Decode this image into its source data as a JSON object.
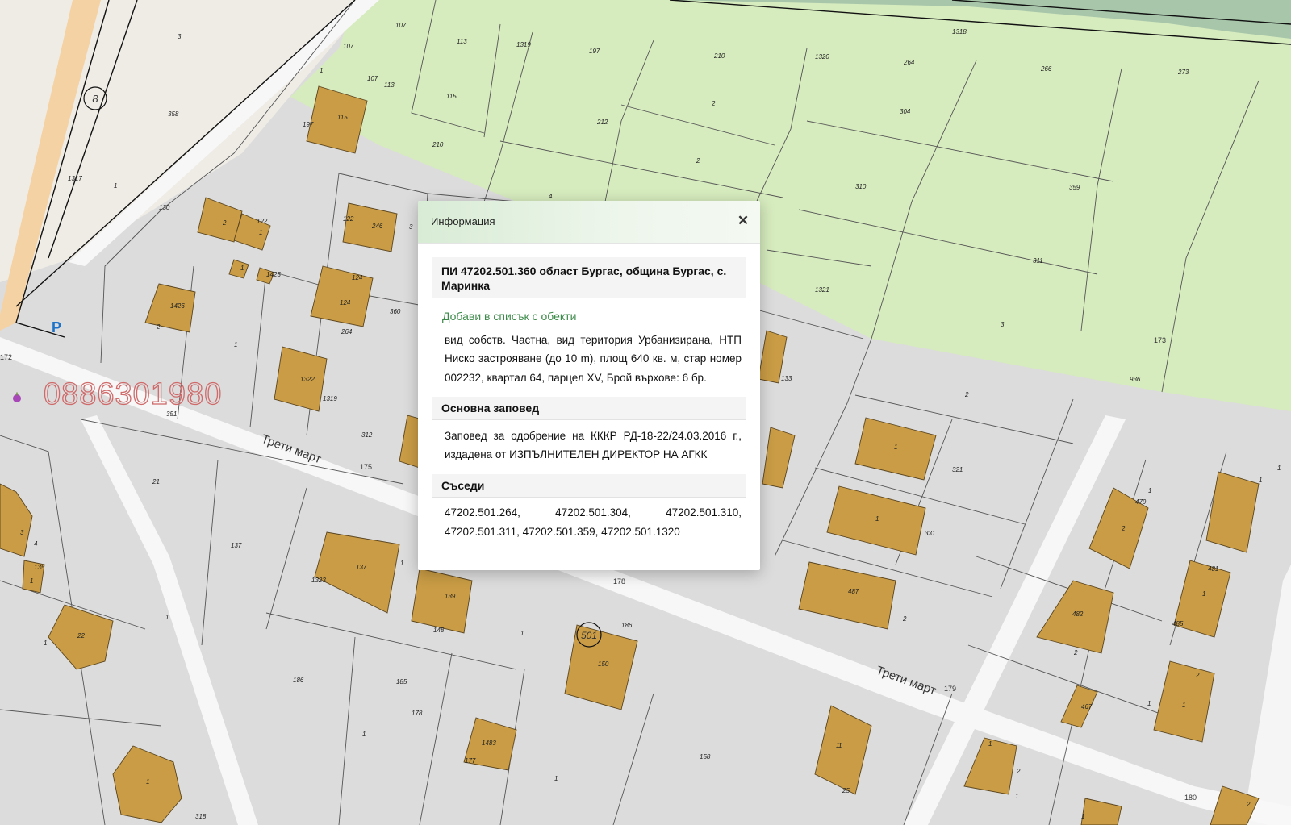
{
  "popup": {
    "title": "Информация",
    "close_icon": "close-icon",
    "parcel_title": "ПИ 47202.501.360 област Бургас, община Бургас, с. Маринка",
    "add_link": "Добави в списък с обекти",
    "description": "вид собств. Частна, вид територия Урбанизирана, НТП Ниско застрояване (до 10 m), площ 640 кв. м, стар номер 002232, квартал 64, парцел XV, Брой върхове: 6 бр.",
    "order_heading": "Основна заповед",
    "order_text": "Заповед за одобрение на КККР РД-18-22/24.03.2016 г., издадена от ИЗПЪЛНИТЕЛЕН ДИРЕКТОР НА АГКК",
    "neighbors_heading": "Съседи",
    "neighbors_text": "47202.501.264, 47202.501.304, 47202.501.310, 47202.501.311, 47202.501.359, 47202.501.1320"
  },
  "map": {
    "colors": {
      "background": "#dcdcdc",
      "agricultural": "#d6ebbe",
      "forest": "#9fbfa7",
      "building": "#c99c45",
      "road": "#f7f7f7",
      "highway": "#f5d2a3",
      "parcel_line": "#333333",
      "watermark": "#d06a6a"
    },
    "watermark_phone": "0886301980",
    "streets": [
      "Трети март",
      "Трети март"
    ],
    "parking_label": "P",
    "circle_labels": [
      "8",
      "501"
    ],
    "poi_labels": [
      "172",
      "175",
      "178",
      "179",
      "173",
      "180"
    ],
    "plot_numbers": [
      "107",
      "113",
      "1319",
      "197",
      "210",
      "1320",
      "264",
      "266",
      "273",
      "1318",
      "107",
      "107",
      "113",
      "115",
      "1",
      "115",
      "197",
      "210",
      "212",
      "2",
      "2",
      "3",
      "358",
      "1317",
      "1",
      "130",
      "2",
      "122",
      "1",
      "122",
      "246",
      "3",
      "4",
      "1",
      "1425",
      "1426",
      "2",
      "1",
      "124",
      "124",
      "264",
      "360",
      "304",
      "310",
      "359",
      "311",
      "1321",
      "3",
      "936",
      "1322",
      "1319",
      "351",
      "312",
      "133",
      "2",
      "21",
      "3",
      "4",
      "135",
      "1",
      "137",
      "137",
      "1",
      "1323",
      "1",
      "22",
      "1",
      "139",
      "148",
      "1",
      "150",
      "186",
      "186",
      "185",
      "178",
      "1",
      "177",
      "1483",
      "1",
      "158",
      "1",
      "25",
      "1",
      "318",
      "1",
      "321",
      "1",
      "331",
      "487",
      "2",
      "1",
      "479",
      "2",
      "1",
      "481",
      "1",
      "485",
      "482",
      "2",
      "1",
      "2",
      "1",
      "467",
      "1",
      "2",
      "1",
      "1",
      "2",
      "1",
      "1"
    ]
  }
}
